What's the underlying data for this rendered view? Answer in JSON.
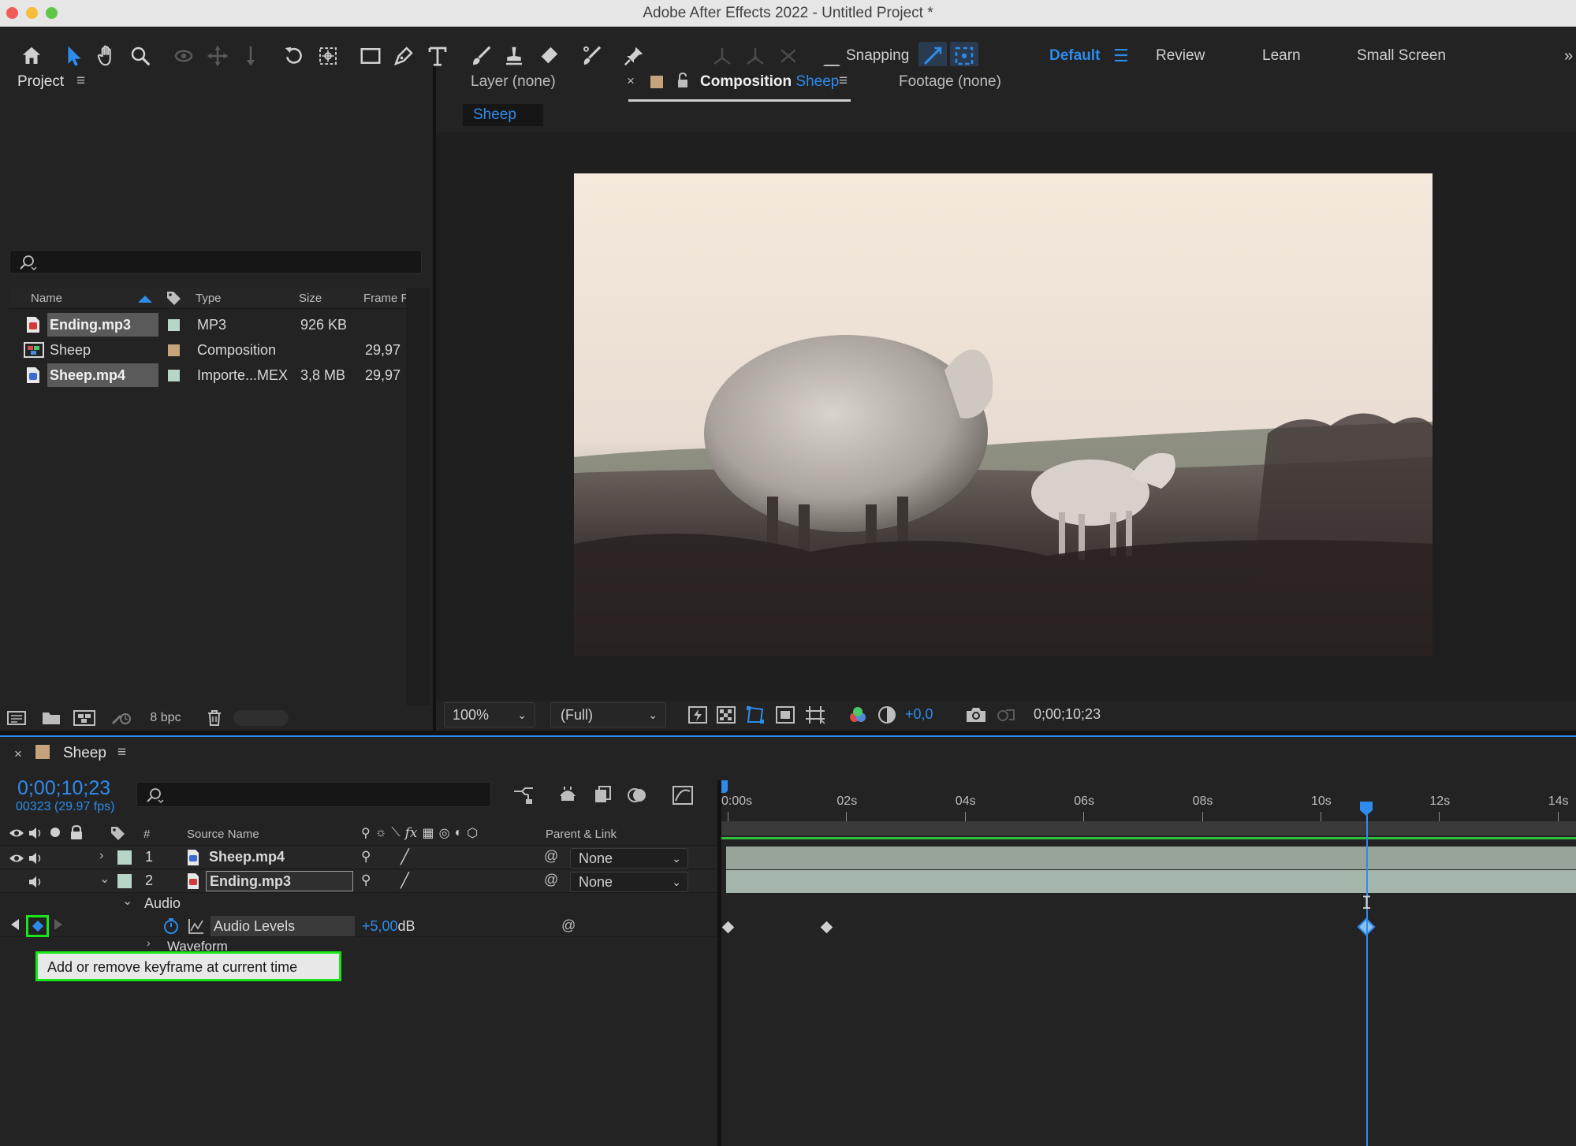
{
  "window": {
    "title": "Adobe After Effects 2022 - Untitled Project *"
  },
  "toolbar": {
    "snapping_label": "Snapping",
    "workspaces": [
      "Default",
      "Review",
      "Learn",
      "Small Screen"
    ],
    "active_workspace": "Default"
  },
  "project": {
    "panel_title": "Project",
    "search_placeholder": "",
    "columns": {
      "name": "Name",
      "type": "Type",
      "size": "Size",
      "frame_rate": "Frame Ra..."
    },
    "items": [
      {
        "name": "Ending.mp3",
        "type": "MP3",
        "size": "926 KB",
        "frame_rate": "",
        "selected": true,
        "label_color": "#b8d6c8"
      },
      {
        "name": "Sheep",
        "type": "Composition",
        "size": "",
        "frame_rate": "29,97",
        "selected": false,
        "label_color": "#c6a37a"
      },
      {
        "name": "Sheep.mp4",
        "type": "Importe...MEX",
        "size": "3,8 MB",
        "frame_rate": "29,97",
        "selected": true,
        "label_color": "#b8d6c8"
      }
    ],
    "bpc_label": "8 bpc"
  },
  "viewer": {
    "tabs": {
      "layer": "Layer (none)",
      "composition_prefix": "Composition",
      "composition_name": "Sheep",
      "footage": "Footage (none)"
    },
    "breadcrumb": "Sheep",
    "zoom": "100%",
    "resolution": "(Full)",
    "exposure": "+0,0",
    "timecode": "0;00;10;23"
  },
  "timeline": {
    "comp_tab": "Sheep",
    "current_time": "0;00;10;23",
    "frame_info": "00323 (29.97 fps)",
    "search_placeholder": "",
    "columns": {
      "number": "#",
      "source_name": "Source Name",
      "parent_link": "Parent & Link"
    },
    "ruler": [
      "0:00s",
      "02s",
      "04s",
      "06s",
      "08s",
      "10s",
      "12s",
      "14s"
    ],
    "ruler_max_seconds": 14.3,
    "playhead_seconds": 10.77,
    "layers": [
      {
        "index": "1",
        "name": "Sheep.mp4",
        "parent": "None",
        "expanded": false
      },
      {
        "index": "2",
        "name": "Ending.mp3",
        "parent": "None",
        "expanded": true
      }
    ],
    "audio_group_label": "Audio",
    "property_name": "Audio Levels",
    "property_value": "+5,00",
    "property_unit": "dB",
    "waveform_label": "Waveform",
    "keyframes_seconds": [
      0,
      1.67,
      10.77
    ],
    "tooltip": "Add or remove keyframe at current time",
    "highlight_color": "#19e619",
    "accent_color": "#2d8ceb"
  }
}
